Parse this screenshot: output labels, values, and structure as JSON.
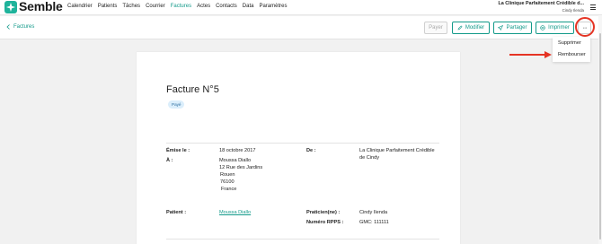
{
  "app": {
    "name": "Semble"
  },
  "nav": {
    "items": [
      "Calendrier",
      "Patients",
      "Tâches",
      "Courrier",
      "Factures",
      "Actes",
      "Contacts",
      "Data",
      "Paramètres"
    ],
    "active": "Factures"
  },
  "clinic": {
    "name": "La Clinique Parfaitement Crédible d...",
    "user": "Cindy Ilenda"
  },
  "toolbar": {
    "back_label": "Factures",
    "payer": "Payer",
    "modifier": "Modifier",
    "partager": "Partager",
    "imprimer": "Imprimer",
    "more": "···"
  },
  "dropdown": {
    "items": [
      "Supprimer",
      "Rembourser"
    ]
  },
  "invoice": {
    "title": "Facture N°5",
    "status": "Payé",
    "issued_label": "Émise le :",
    "issued_date": "18 octobre 2017",
    "to_label": "À :",
    "to_lines": [
      "Moussa Diallo",
      "12 Rue des Jardins",
      "Rouen",
      "76100",
      "France"
    ],
    "from_label": "De :",
    "from_lines": [
      "La Clinique Parfaitement Crédible",
      "de Cindy"
    ],
    "patient_label": "Patient :",
    "patient_name": "Moussa Diallo",
    "practitioner_label": "Praticien(ne) :",
    "practitioner_name": "Cindy Ilenda",
    "rpps_label": "Numéro RPPS :",
    "rpps_value": "GMC: 111111"
  },
  "colors": {
    "accent": "#139a8a",
    "annotation": "#e53424",
    "badge_bg": "#dbeefb"
  }
}
